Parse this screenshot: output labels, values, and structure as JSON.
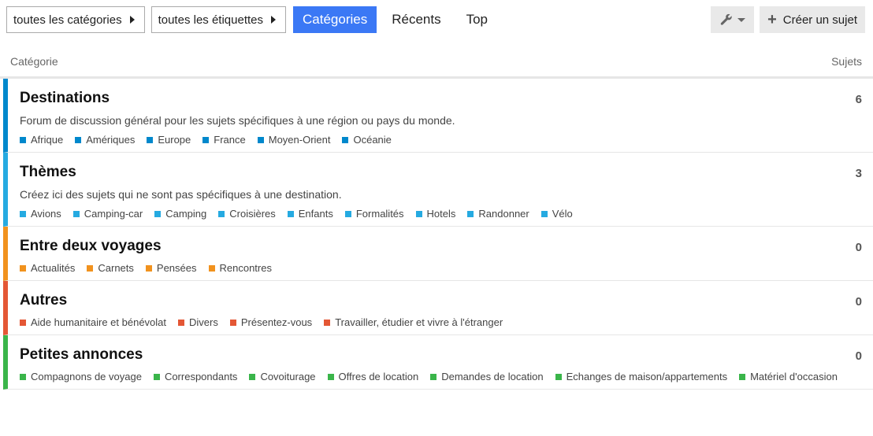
{
  "nav": {
    "categories_dropdown": "toutes les catégories",
    "tags_dropdown": "toutes les étiquettes",
    "tabs": [
      "Catégories",
      "Récents",
      "Top"
    ],
    "tools_icon": "wrench-icon",
    "create_label": "Créer un sujet"
  },
  "table": {
    "col_category": "Catégorie",
    "col_topics": "Sujets"
  },
  "categories": [
    {
      "title": "Destinations",
      "color": "#0088cc",
      "description": "Forum de discussion général pour les sujets spécifiques à une région ou pays du monde.",
      "count": "6",
      "subs": [
        "Afrique",
        "Amériques",
        "Europe",
        "France",
        "Moyen-Orient",
        "Océanie"
      ]
    },
    {
      "title": "Thèmes",
      "color": "#25aae1",
      "description": "Créez ici des sujets qui ne sont pas spécifiques à une destination.",
      "count": "3",
      "subs": [
        "Avions",
        "Camping-car",
        "Camping",
        "Croisières",
        "Enfants",
        "Formalités",
        "Hotels",
        "Randonner",
        "Vélo"
      ]
    },
    {
      "title": "Entre deux voyages",
      "color": "#f1921e",
      "description": "",
      "count": "0",
      "subs": [
        "Actualités",
        "Carnets",
        "Pensées",
        "Rencontres"
      ]
    },
    {
      "title": "Autres",
      "color": "#e45735",
      "description": "",
      "count": "0",
      "subs": [
        "Aide humanitaire et bénévolat",
        "Divers",
        "Présentez-vous",
        "Travailler, étudier et vivre à l'étranger"
      ]
    },
    {
      "title": "Petites annonces",
      "color": "#3ab54a",
      "description": "",
      "count": "0",
      "subs": [
        "Compagnons de voyage",
        "Correspondants",
        "Covoiturage",
        "Offres de location",
        "Demandes de location",
        "Echanges de maison/appartements",
        "Matériel d'occasion"
      ]
    }
  ]
}
